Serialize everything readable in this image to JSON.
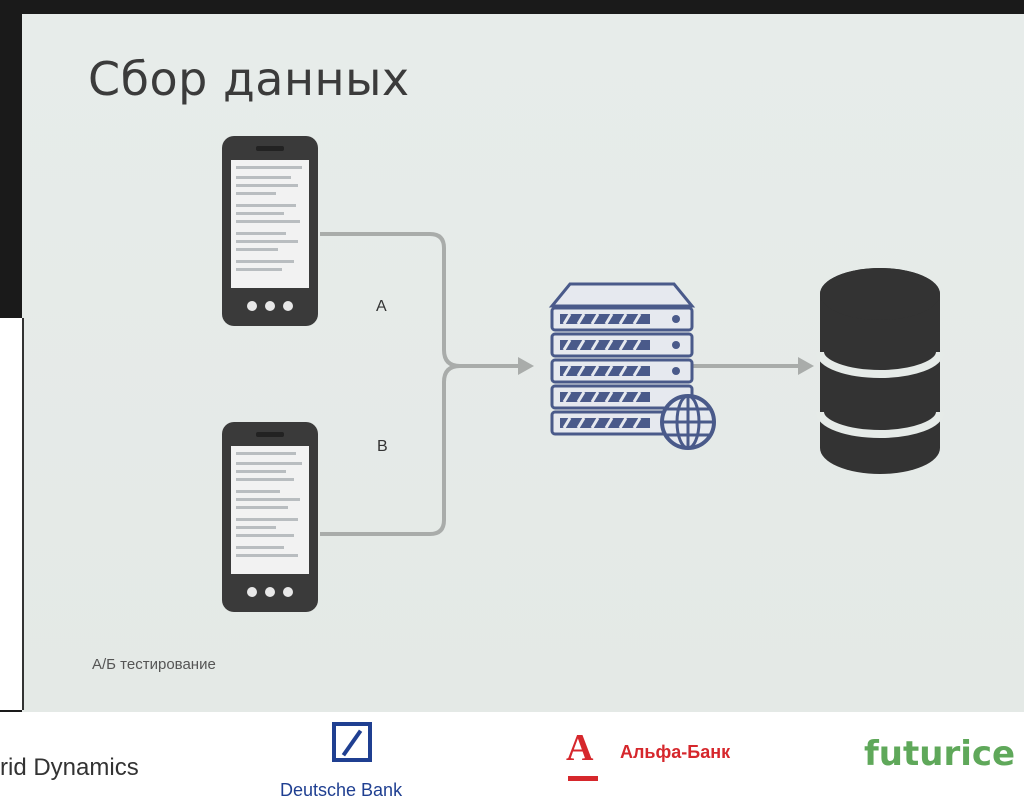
{
  "slide": {
    "title": "Сбор данных",
    "label_a": "A",
    "label_b": "B",
    "caption": "А/Б тестирование"
  },
  "sponsors": {
    "grid": "rid Dynamics",
    "deutsche_bank": "Deutsche Bank",
    "alfa_logo": "А",
    "alfa_bank": "Альфа-Банк",
    "futurice": "futurice"
  },
  "colors": {
    "phone": "#3a3a3a",
    "server": "#4a5a8a",
    "database": "#333333",
    "connector": "#a9acaa",
    "alfa_red": "#d6272c",
    "db_blue": "#1f3f91",
    "futurice_green": "#5fa85a"
  },
  "icons": [
    "smartphone-icon",
    "server-icon",
    "globe-icon",
    "database-icon"
  ]
}
